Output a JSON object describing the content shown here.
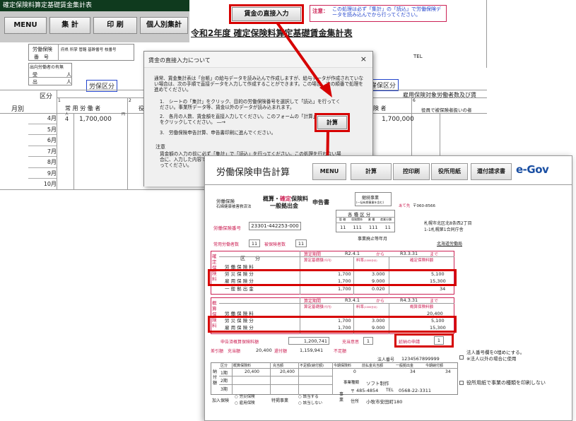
{
  "back_sheet": {
    "window_title": "確定保険料算定基礎賃金集計表",
    "buttons": [
      "MENU",
      "集 計",
      "印 刷",
      "個人別集計"
    ],
    "heading": "令和2年度 確定保険料算定基礎賃金集計表",
    "direct_input_button": "賃金の直接入力",
    "note_label": "注意：",
    "note_text": "この処理は必ず「集計」の「読込」で労働保険データを読み込んでから行ってください。",
    "labor_ins_label": "労働保険",
    "number_label": "番　号",
    "number_cols": "府県 所掌 管轄 基幹番号 枝番号",
    "dispatch_label": "出向労働者の有無",
    "dispatch_receive": "受",
    "dispatch_send": "出",
    "person_unit": "人",
    "tel_label": "TEL",
    "kubun_label": "区分",
    "month_label": "月別",
    "rousai_tag": "労保区分",
    "koyo_tag": "雇保区分",
    "col_jouyou": "常 用 労 働 者",
    "col_kubun1": "1",
    "col_kubun2": "2",
    "col_role": "役",
    "col_hoken": "険 者",
    "col_kubun6": "6",
    "col_yakuin": "役員で被保険者扱いの者",
    "koyo_count_label": "雇用保険対象労働者数及び賃",
    "unit_person": "人",
    "unit_yen": "円",
    "months": [
      "4月",
      "5月",
      "6月",
      "7月",
      "8月",
      "9月",
      "10月"
    ],
    "april_count": "4",
    "april_wage": "1,700,000",
    "april_wage_right": "1,700,000"
  },
  "dialog": {
    "title": "賃金の直接入力について",
    "close": "×",
    "intro": "通常、賃金集計表は「台帳」の給与データを読み込んで作成しますが、給与データが作成されていない場合は、次の手順で直接データを入力して作成することができます。この場合、次の順番で処理を進めてください。",
    "step1": "1.　シートの「集計」をクリック、目的の労働保険番号を選択して「読込」を行ってください。事業所データ等、賃金以外のデータが読み込まれます。",
    "step2": "2.　各月の人数、賃金額を直接入力してください。このフォームの「計算」をクリックしてください。 ―→",
    "step3": "3.　労働保険申告計算、申告書印刷に進んでください。",
    "note_title": "注意",
    "note_body": "賃金額の入力の前に必ず「集計」で「読込」を行ってください。この処理を行わない場合に、入力した内容で上書きされますのでご注意ください。集計・帳簿は必ず登録を行ってください。",
    "calc_button": "計算"
  },
  "calc_sheet": {
    "title": "労働保険申告計算",
    "buttons": [
      "MENU",
      "計算",
      "控印刷",
      "役所用紙",
      "還付請求書"
    ],
    "logo": "e-Gov",
    "form_header_left1": "労働保険",
    "form_header_left2": "石綿健康被害救済法",
    "form_title1": "概算・確定保険料",
    "form_title2": "一般拠出金",
    "form_title3": "申告書",
    "continued": "継続事業",
    "continued_sub": "(一括有期事業を含む)",
    "to_label": "あて先",
    "postal": "〒060-8566",
    "address1": "札幌市北区北8条西2丁目",
    "address2": "1-1札幌第1合同庁舎",
    "office": "北海道労働局",
    "kubun_head": "各 種 区 分",
    "kubun_sub": [
      "管 轄",
      "保険関係",
      "業 種",
      "産業分類"
    ],
    "kubun_vals": [
      "11",
      "111",
      "111",
      "11"
    ],
    "ins_no_label": "労働保険番号",
    "ins_no": "23301-442253-000",
    "jouyou_label": "常用労働者数",
    "jouyou_val": "11",
    "hihoken_label": "被保険者数",
    "hihoken_val": "11",
    "abolished": "事業廃止等年月",
    "kakutei_side": "確定保険料",
    "gaisan_side": "概算保険料",
    "kubun_col": "区　　分",
    "period_label": "算定期間",
    "period1_from": "R2.4.1",
    "period1_to": "R3.3.31",
    "period2_from": "R3.4.1",
    "period2_to": "R4.3.31",
    "kara": "から",
    "made": "まで",
    "basis_label": "算定基礎額",
    "basis_unit": "(千円)",
    "rate_label": "料率",
    "rate_unit": "(1000分の)",
    "kakutei_amount_label": "確定保険料額",
    "gaisan_amount_label": "概算保険料額",
    "rows_k": [
      {
        "name": "労 働 保 険 料",
        "basis": "",
        "rate": "",
        "amt": ""
      },
      {
        "name": "労 災 保 険 分",
        "basis": "1,700",
        "rate": "3.000",
        "amt": "5,100"
      },
      {
        "name": "雇 用 保 険 分",
        "basis": "1,700",
        "rate": "9.000",
        "amt": "15,300"
      },
      {
        "name": "一 般 拠 出 金",
        "basis": "1,700",
        "rate": "0.020",
        "amt": "34"
      }
    ],
    "rows_g": [
      {
        "name": "労 働 保 険 料",
        "basis": "",
        "rate": "",
        "amt": "20,400"
      },
      {
        "name": "労 災 保 険 分",
        "basis": "1,700",
        "rate": "3.000",
        "amt": "5,100"
      },
      {
        "name": "雇 用 保 険 分",
        "basis": "1,700",
        "rate": "9.000",
        "amt": "15,300"
      }
    ],
    "gaisan_total_basis": "12,000",
    "gaisan_total_amt": "20,400",
    "kakutei_basis_total": "17,000",
    "kakutei_amt_total": "20,434",
    "declared_label": "申告済概算保険料額",
    "declared_val": "1,200,741",
    "instalment_label": "延納の申請",
    "instalment_val": "1",
    "surplus_label": "充当意思",
    "surplus_val": "1",
    "deduct_label": "差引額",
    "jutou_label": "充当額",
    "jutou_val": "20,400",
    "kanpu_label": "還付額",
    "kanpu_val": "1,159,941",
    "fusoku_label": "不足額",
    "corp_no_label": "法人番号",
    "corp_no": "1234567899999",
    "corp_note1": "法人番号欄を0埋めにする。",
    "corp_note2": "※法人以外の場合に使用",
    "pay_cols": [
      "区分",
      "概算保険料",
      "充当額",
      "不足額(納付額)",
      "今期保険料",
      "前払金充当額",
      "一般拠出金",
      "今期納付額"
    ],
    "pay_rows": [
      {
        "k": "1期",
        "g": "20,400",
        "j": "20,400",
        "f": "",
        "t": "0",
        "m": "",
        "i": "34",
        "n": "34"
      },
      {
        "k": "2期",
        "g": "",
        "j": "",
        "f": "",
        "t": "",
        "m": "",
        "i": "",
        "n": ""
      },
      {
        "k": "3期",
        "g": "",
        "j": "",
        "f": "",
        "t": "",
        "m": "",
        "i": "",
        "n": ""
      }
    ],
    "pay_side": "納付額",
    "biz_type_label": "事業種類",
    "biz_type": "ソフト制作",
    "zip_label": "〒",
    "zip": "485-4854",
    "tel_label": "TEL",
    "tel": "0568-22-3311",
    "addr_label": "住所",
    "addr": "小牧市安田町180",
    "jigyou_side": "事業",
    "kanyu_label": "加入保険",
    "kanyu_opt1": "労災保険",
    "kanyu_opt2": "雇用保険",
    "tokutei_label": "特掲事業",
    "tokutei_opt1": "該当する",
    "tokutei_opt2": "該当しない",
    "print_check_label": "役所用紙で事業の種類を印刷しない"
  }
}
